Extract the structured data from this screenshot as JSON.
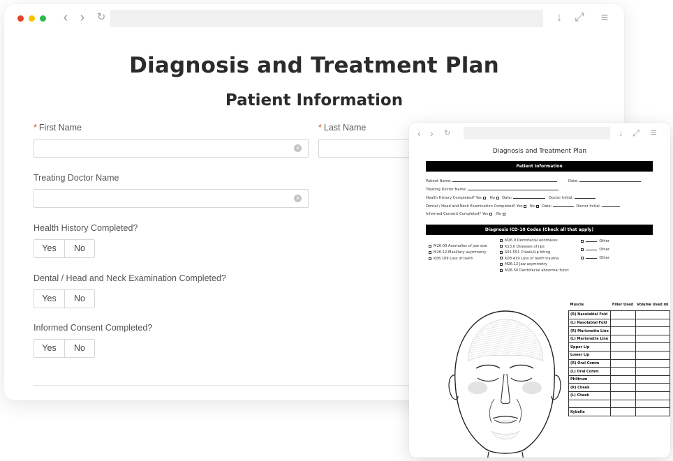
{
  "form": {
    "title": "Diagnosis and Treatment Plan",
    "section_title": "Patient Information",
    "first_name_label": "First Name",
    "last_name_label": "Last Name",
    "required_marker": "*",
    "treating_doctor_label": "Treating Doctor Name",
    "health_history_label": "Health History Completed?",
    "dental_exam_label": "Dental / Head and Neck Examination Completed?",
    "consent_label": "Informed Consent Completed?",
    "yes_label": "Yes",
    "no_label": "No"
  },
  "document": {
    "title": "Diagnosis and Treatment Plan",
    "section_bar": "Patient Information",
    "patient_name": "Patient Name:",
    "date": "Date:",
    "treating_doctor": "Treating Doctor Name:",
    "health_history": "Health History Completed?  Yes",
    "no": "No",
    "date2": "Date:",
    "doctor_initial": "Doctor Initial:",
    "dental_exam": "Dental / Head and Neck Examination Completed? Yes",
    "doctor_initial2": "Doctor Initial:",
    "consent": "Informed Consent Completed?  Yes",
    "diag_bar": "Diagnosis  ICD-10 Codes (Check all that apply)",
    "codes_left": [
      "M26.00 Anomalies of jaw size",
      "M26.12 Maxillary asymmetry",
      "K08.109 Loss of teeth"
    ],
    "codes_mid": [
      "M26.9 Dentofacial anomalies",
      "K13.0 Diseases of lips",
      "S01.551 Cheek/Lip biting",
      "K08.419 Loss of teeth trauma",
      "M26.12 Jaw asymmetry",
      "M26.50 Dentofacial abnormal funct"
    ],
    "other": "Other",
    "table_headers": [
      "Muscle",
      "Filler Used",
      "Volume Used ml"
    ],
    "muscles": [
      "(R) Nasolabial Fold",
      "(L) Nasolabial Fold",
      "(R) Marionette Line",
      "(L) Marionette Line",
      "Upper Lip",
      "Lower Lip",
      "(R) Oral Comm",
      "(L) Oral Comm",
      "Philtrum",
      "(R) Cheek",
      "(L) Cheek",
      "",
      "Kybella"
    ]
  }
}
